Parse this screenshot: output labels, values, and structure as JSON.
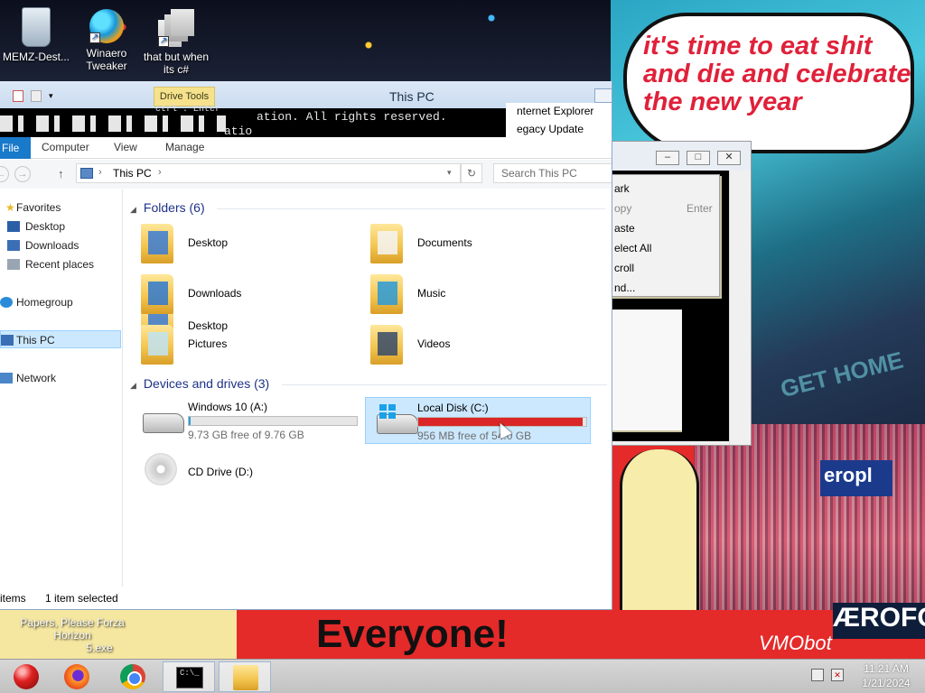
{
  "desktop": {
    "icons": [
      {
        "label": "MEMZ-Dest...",
        "icon": "recycle-bin-icon"
      },
      {
        "label_line1": "Winaero",
        "label_line2": "Tweaker",
        "icon": "winaero-tweaker-icon"
      },
      {
        "label_line1": "that but when",
        "label_line2": "its c#",
        "icon": "shortcut-stack-icon"
      },
      {
        "label_line1": "Papers, Please Forza Horizon",
        "label_line2": "5.exe",
        "icon": "exe-icon"
      }
    ],
    "bubble_lines": [
      "it's time to eat shit",
      "and die and celebrate",
      "the new year"
    ],
    "wallpaper_text": {
      "everyone": "Everyone!",
      "sign_get_home": "GET HOME",
      "sign_aerop": "eropl",
      "sign_aerofos": "ÆROFOS",
      "sign_bottom": "VMObot"
    }
  },
  "console": {
    "menu_items": [
      {
        "label": "ark",
        "shortcut": ""
      },
      {
        "label": "opy",
        "shortcut": "Enter"
      },
      {
        "label": "aste",
        "shortcut": ""
      },
      {
        "label": "elect All",
        "shortcut": ""
      },
      {
        "label": "croll",
        "shortcut": ""
      },
      {
        "label": "nd...",
        "shortcut": ""
      }
    ],
    "buttons": {
      "minimize": "–",
      "maximize": "□",
      "close": "✕"
    }
  },
  "explorer": {
    "title": "This PC",
    "context_tab": "Drive Tools",
    "glitch_text_1": "ation. All rights reserved.",
    "glitch_text_2": "atio",
    "glitch_text_3": "ctrl . Enter",
    "overlay_links": [
      "nternet Explorer",
      "egacy Update"
    ],
    "ribbon_tabs": {
      "file": "File",
      "computer": "Computer",
      "view": "View",
      "manage": "Manage"
    },
    "address": {
      "path": "This PC",
      "chevron": "›"
    },
    "search": {
      "placeholder": "Search This PC"
    },
    "nav": {
      "favorites": "Favorites",
      "desktop": "Desktop",
      "downloads": "Downloads",
      "recent_places": "Recent places",
      "homegroup": "Homegroup",
      "this_pc": "This PC",
      "network": "Network"
    },
    "groups": {
      "folders": "Folders (6)",
      "devices": "Devices and drives (3)"
    },
    "folders": [
      "Desktop",
      "Documents",
      "Downloads",
      "Music",
      "Pictures",
      "Videos"
    ],
    "drives": [
      {
        "name": "Windows 10 (A:)",
        "free": "9.73 GB free of 9.76 GB",
        "used_fraction": 0.003,
        "bar_color": "#26a0da"
      },
      {
        "name": "Local Disk (C:)",
        "free": "956 MB free of 54.0 GB",
        "used_fraction": 0.98,
        "bar_color": "#da2626"
      },
      {
        "name": "CD Drive (D:)"
      }
    ],
    "status": {
      "items": "items",
      "selected": "1 item selected"
    }
  },
  "taskbar": {
    "apps": [
      "start-ornament-icon",
      "firefox-icon",
      "chrome-icon",
      "command-prompt-icon",
      "file-explorer-icon"
    ],
    "cmd_glyph": "C:\\_",
    "clock": {
      "time": "11:21 AM",
      "date": "1/21/2024"
    }
  },
  "colors": {
    "accent": "#1979ca",
    "selection": "#cce8ff",
    "danger": "#da2626",
    "bubble_text": "#e0213a"
  }
}
